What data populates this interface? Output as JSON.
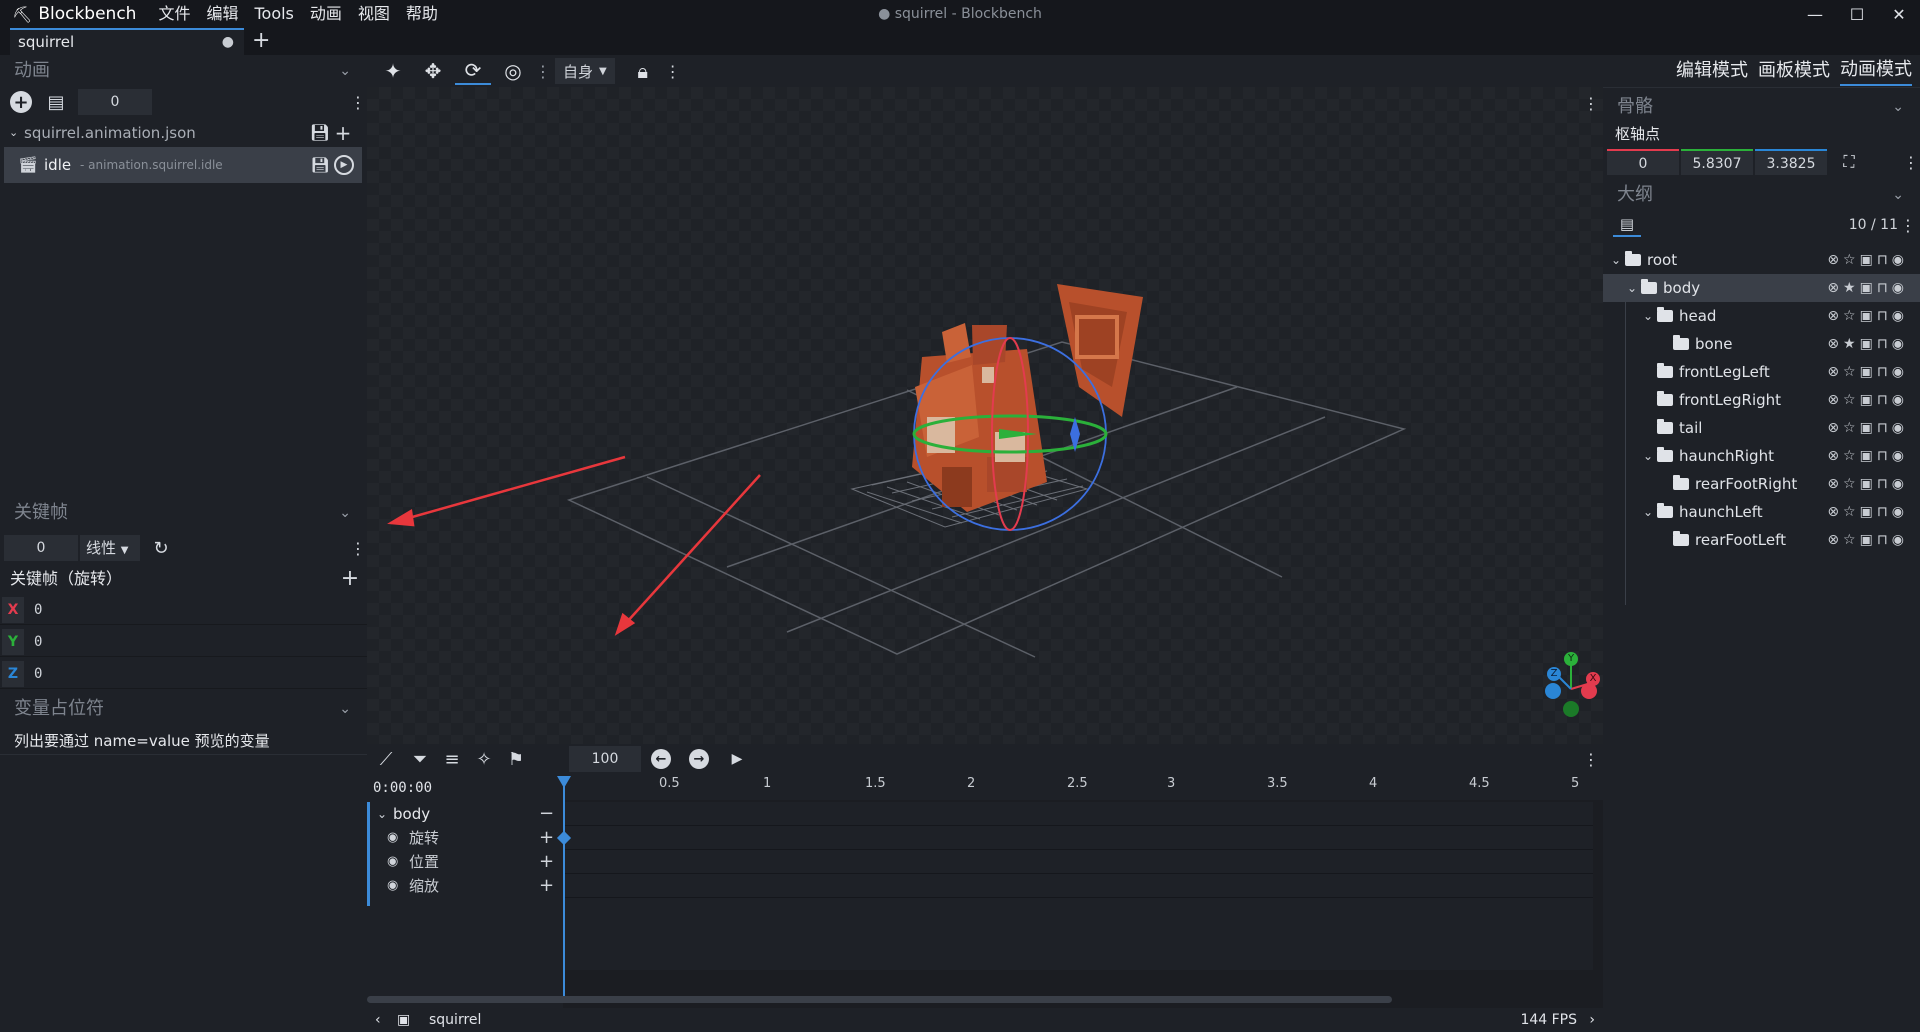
{
  "app": {
    "name": "Blockbench",
    "window_title": "● squirrel - Blockbench"
  },
  "menu": [
    "文件",
    "编辑",
    "Tools",
    "动画",
    "视图",
    "帮助"
  ],
  "tabs": [
    {
      "label": "squirrel",
      "unsaved_marker": "●"
    }
  ],
  "left": {
    "animation_panel": {
      "title": "动画",
      "counter": "0",
      "file": "squirrel.animation.json",
      "item_name": "idle",
      "item_id": "- animation.squirrel.idle"
    },
    "keyframe_panel": {
      "title": "关键帧",
      "time_value": "0",
      "interpolation": "线性",
      "channel_title": "关键帧（旋转）",
      "x_label": "X",
      "x_value": "0",
      "y_label": "Y",
      "y_value": "0",
      "z_label": "Z",
      "z_value": "0"
    },
    "variable_panel": {
      "title": "变量占位符",
      "hint": "列出要通过 name=value 预览的变量"
    }
  },
  "toolbar": {
    "space": "自身"
  },
  "right": {
    "modes": [
      "编辑模式",
      "画板模式",
      "动画模式"
    ],
    "active_mode": "动画模式",
    "bones_panel": {
      "title": "骨骼",
      "pivot_label": "枢轴点",
      "pivot": [
        "0",
        "5.8307",
        "3.3825"
      ]
    },
    "outliner": {
      "title": "大纲",
      "count": "10 / 11",
      "items": [
        {
          "name": "root"
        },
        {
          "name": "body"
        },
        {
          "name": "head"
        },
        {
          "name": "bone"
        },
        {
          "name": "frontLegLeft"
        },
        {
          "name": "frontLegRight"
        },
        {
          "name": "tail"
        },
        {
          "name": "haunchRight"
        },
        {
          "name": "rearFootRight"
        },
        {
          "name": "haunchLeft"
        },
        {
          "name": "rearFootLeft"
        }
      ]
    }
  },
  "timeline": {
    "zoom": "100",
    "time": "0:00:00",
    "ruler": [
      "0.5",
      "1",
      "1.5",
      "2",
      "2.5",
      "3",
      "3.5",
      "4",
      "4.5",
      "5"
    ],
    "group": "body",
    "channels": [
      "旋转",
      "位置",
      "缩放"
    ]
  },
  "gizmo": {
    "y": "Y",
    "x": "X",
    "z": "Z",
    "color_x": "#e33b4e",
    "color_y": "#2bb03a",
    "color_z": "#2a86d6"
  },
  "status": {
    "model": "squirrel",
    "fps": "144 FPS"
  },
  "colors": {
    "accent": "#3c8bd9",
    "arrow": "#e8373c",
    "model": "#b8502c"
  }
}
